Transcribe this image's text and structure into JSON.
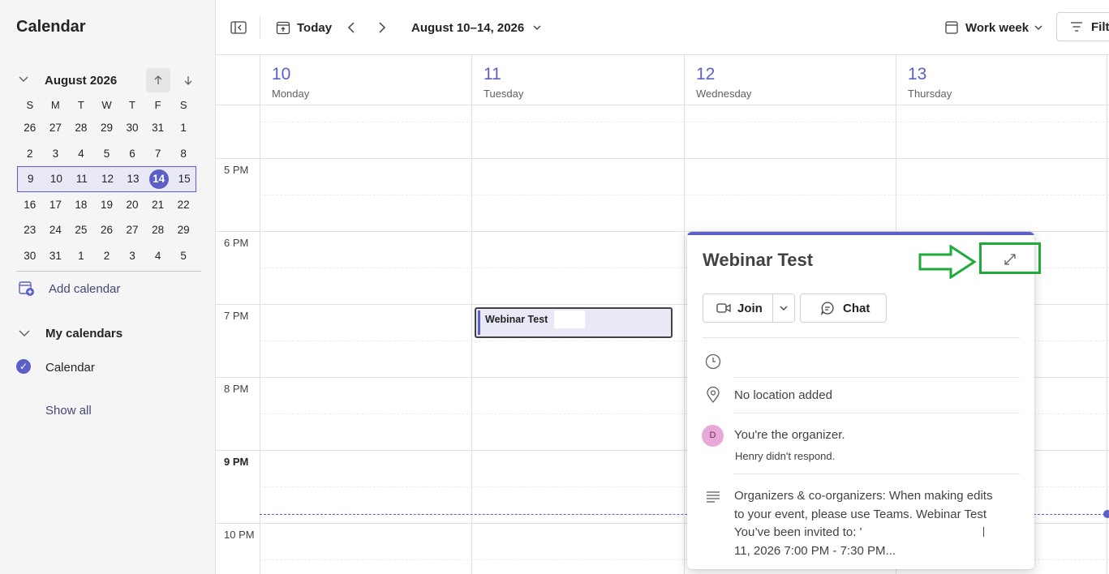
{
  "app": {
    "title": "Calendar"
  },
  "mini_calendar": {
    "month_label": "August 2026",
    "weekdays": [
      "S",
      "M",
      "T",
      "W",
      "T",
      "F",
      "S"
    ],
    "weeks": [
      [
        "26",
        "27",
        "28",
        "29",
        "30",
        "31",
        "1"
      ],
      [
        "2",
        "3",
        "4",
        "5",
        "6",
        "7",
        "8"
      ],
      [
        "9",
        "10",
        "11",
        "12",
        "13",
        "14",
        "15"
      ],
      [
        "16",
        "17",
        "18",
        "19",
        "20",
        "21",
        "22"
      ],
      [
        "23",
        "24",
        "25",
        "26",
        "27",
        "28",
        "29"
      ],
      [
        "30",
        "31",
        "1",
        "2",
        "3",
        "4",
        "5"
      ]
    ],
    "today": "14",
    "selected_week_index": 2
  },
  "sidebar": {
    "add_calendar": "Add calendar",
    "my_calendars": "My calendars",
    "calendar_item": "Calendar",
    "show_all": "Show all"
  },
  "toolbar": {
    "today": "Today",
    "date_range": "August 10–14, 2026",
    "view": "Work week",
    "filter": "Filt"
  },
  "days": [
    {
      "num": "10",
      "name": "Monday"
    },
    {
      "num": "11",
      "name": "Tuesday"
    },
    {
      "num": "12",
      "name": "Wednesday"
    },
    {
      "num": "13",
      "name": "Thursday"
    }
  ],
  "time_labels": [
    "5 PM",
    "6 PM",
    "7 PM",
    "8 PM",
    "9 PM",
    "10 PM"
  ],
  "current_hour_label": "9 PM",
  "event": {
    "title": "Webinar Test"
  },
  "popup": {
    "title": "Webinar Test",
    "join": "Join",
    "chat": "Chat",
    "location": "No location added",
    "organizer": "You're the organizer.",
    "response": "Henry didn't respond.",
    "avatar_initial": "D",
    "description_lines": [
      "Organizers & co-organizers: When making edits",
      "to your event, please use Teams. Webinar Test",
      "You’ve been invited to: '",
      "11, 2026 7:00 PM - 7:30 PM..."
    ]
  },
  "colors": {
    "accent": "#5b5fc7",
    "annotation": "#1faa3a",
    "avatar": "#e8a8d8"
  }
}
